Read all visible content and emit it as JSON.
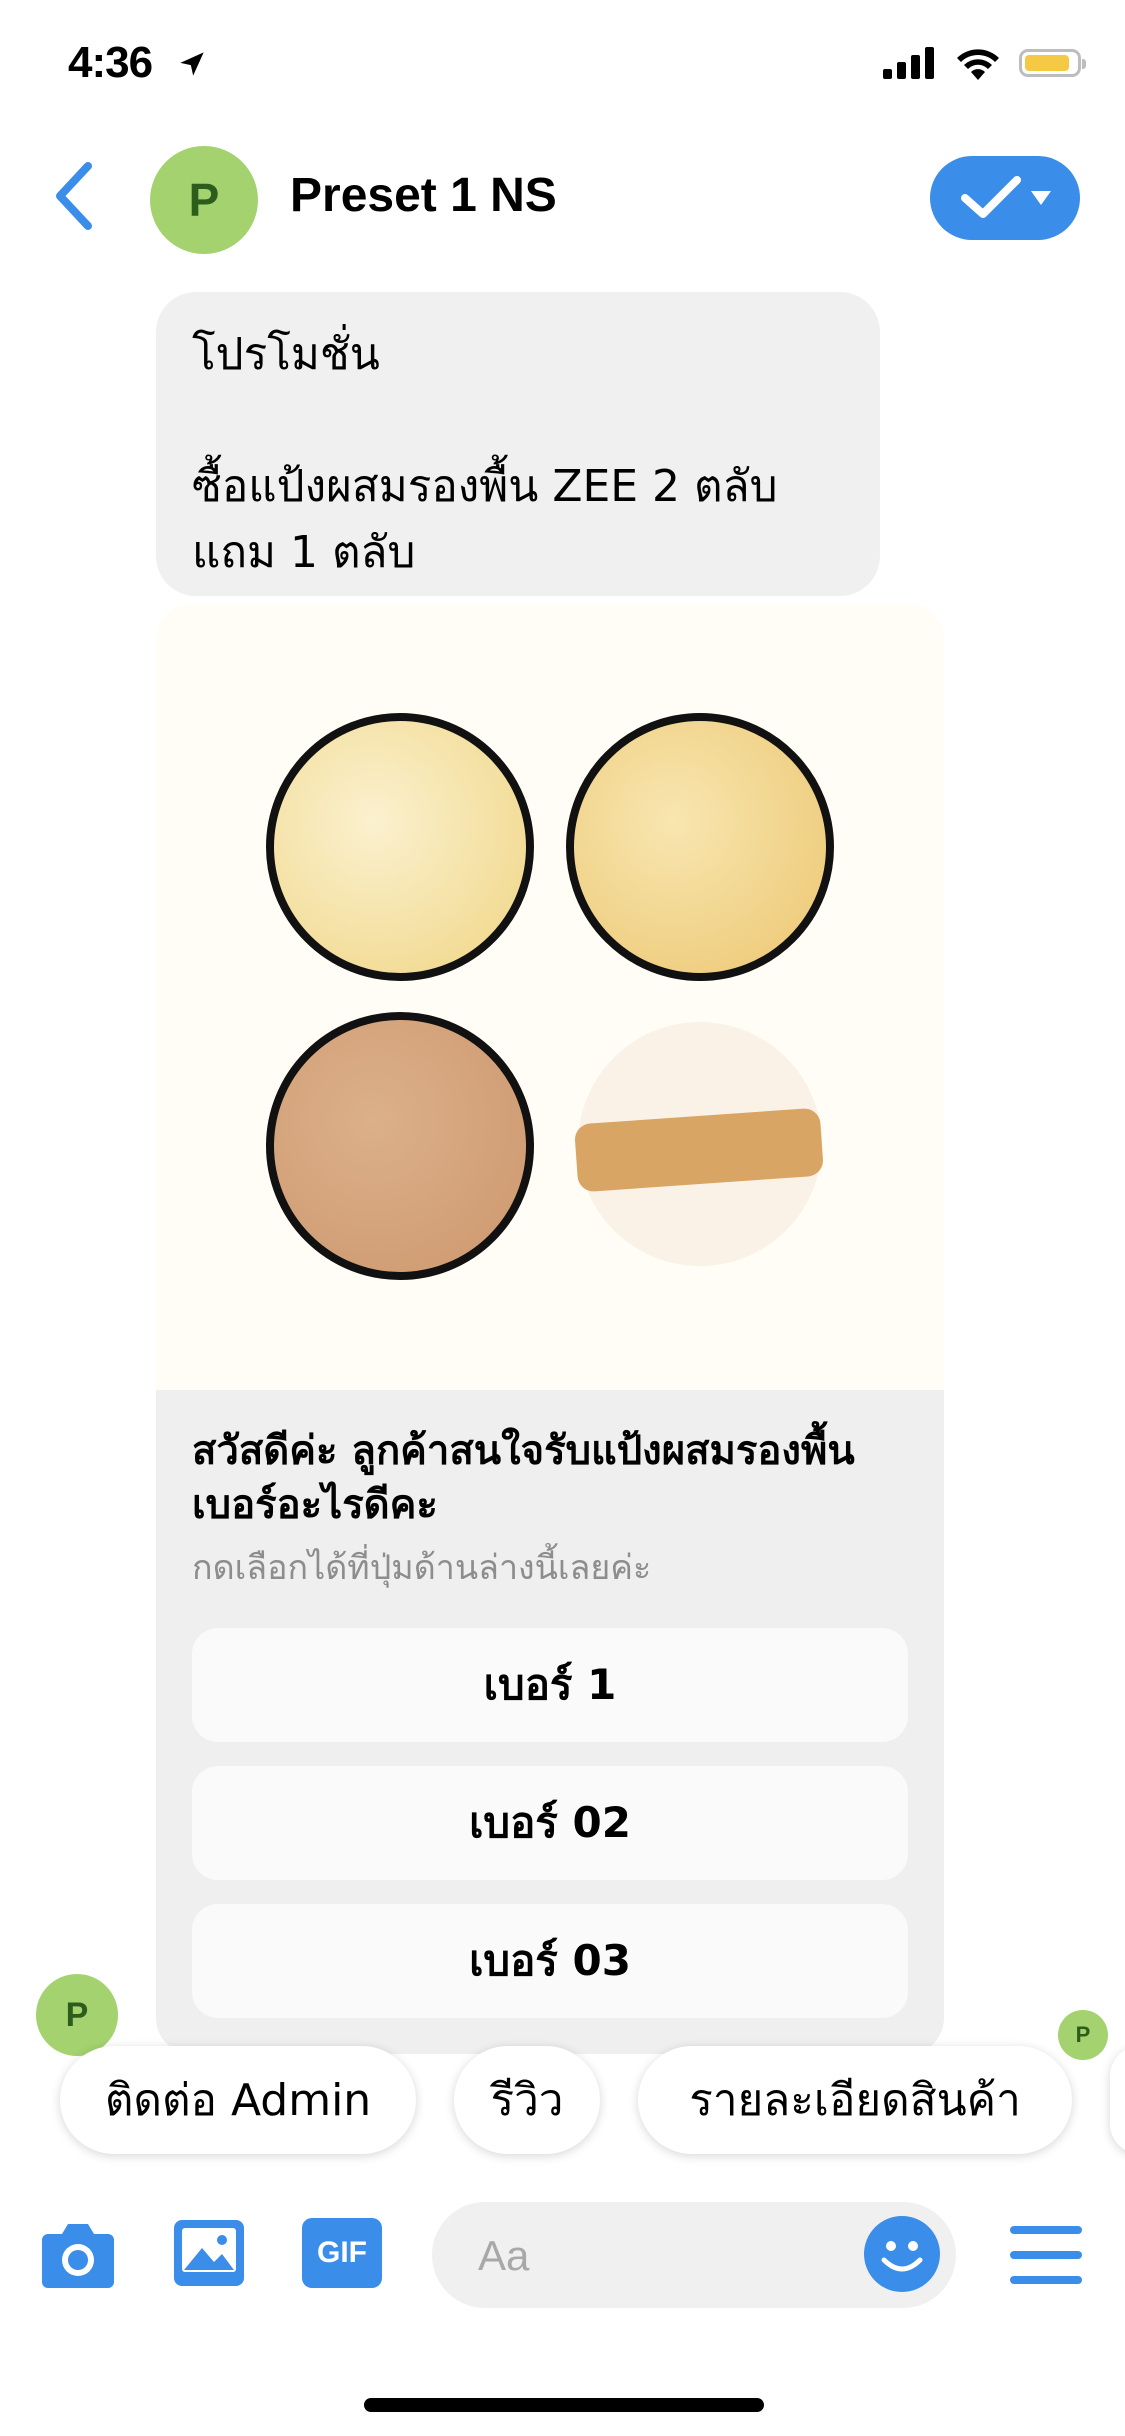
{
  "status": {
    "time": "4:36"
  },
  "header": {
    "title": "Preset 1 NS",
    "avatar_letter": "P"
  },
  "message": {
    "line1": "โปรโมชั่น",
    "line2": "ซื้อแป้งผสมรองพื้น ZEE 2 ตลับ\nแถม 1 ตลับ"
  },
  "card": {
    "title": "สวัสดีค่ะ ลูกค้าสนใจรับแป้งผสมรองพื้นเบอร์อะไรดีคะ",
    "subtitle": "กดเลือกได้ที่ปุ่มด้านล่างนี้เลยค่ะ",
    "buttons": [
      "เบอร์ 1",
      "เบอร์ 02",
      "เบอร์ 03"
    ]
  },
  "quick_replies": [
    "ติดต่อ Admin",
    "รีวิว",
    "รายละเอียดสินค้า"
  ],
  "composer": {
    "placeholder": "Aa",
    "gif_label": "GIF"
  },
  "colors": {
    "accent": "#3a8de8",
    "avatar": "#a3d26f",
    "bubble": "#f0f0f0"
  }
}
